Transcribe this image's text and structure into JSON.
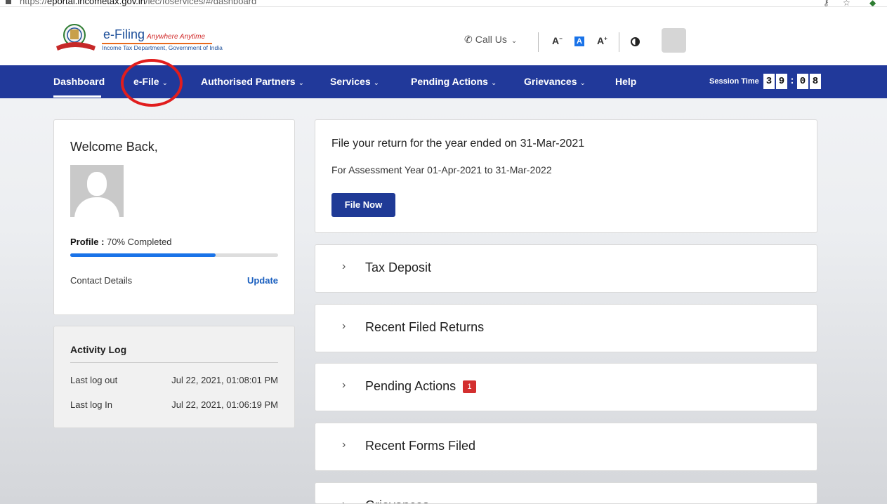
{
  "browser": {
    "url_prefix": "https://",
    "url_host": "eportal.incometax.gov.in",
    "url_path": "/iec/foservices/#/dashboard"
  },
  "header": {
    "brand": "e-Filing",
    "tagline": "Anywhere Anytime",
    "department": "Income Tax Department, Government of India",
    "call_us": "Call Us",
    "font_decrease": "A",
    "font_normal": "A",
    "font_increase": "A+"
  },
  "nav": {
    "items": [
      {
        "label": "Dashboard",
        "dropdown": false
      },
      {
        "label": "e-File",
        "dropdown": true
      },
      {
        "label": "Authorised Partners",
        "dropdown": true
      },
      {
        "label": "Services",
        "dropdown": true
      },
      {
        "label": "Pending Actions",
        "dropdown": true
      },
      {
        "label": "Grievances",
        "dropdown": true
      },
      {
        "label": "Help",
        "dropdown": false
      }
    ],
    "session_label": "Session Time",
    "session_digits": [
      "3",
      "9",
      ":",
      "0",
      "8"
    ]
  },
  "welcome": {
    "title": "Welcome Back,",
    "profile_label": "Profile :",
    "profile_value": "70% Completed",
    "profile_progress": 0.7,
    "contact_label": "Contact Details",
    "update_label": "Update"
  },
  "activity": {
    "title": "Activity Log",
    "rows": [
      {
        "label": "Last log out",
        "value": "Jul 22, 2021, 01:08:01 PM"
      },
      {
        "label": "Last log In",
        "value": "Jul 22, 2021, 01:06:19 PM"
      }
    ]
  },
  "file_return": {
    "title": "File your return for the year ended on 31-Mar-2021",
    "subtitle": "For Assessment Year 01-Apr-2021 to 31-Mar-2022",
    "button": "File Now"
  },
  "accordions": [
    {
      "title": "Tax Deposit",
      "badge": ""
    },
    {
      "title": "Recent Filed Returns",
      "badge": ""
    },
    {
      "title": "Pending Actions",
      "badge": "1"
    },
    {
      "title": "Recent Forms Filed",
      "badge": ""
    },
    {
      "title": "Grievances",
      "badge": ""
    }
  ],
  "colors": {
    "nav_bg": "#21399a",
    "accent": "#1a73e8",
    "highlight_circle": "#e11d1d",
    "badge": "#d32f2f"
  }
}
